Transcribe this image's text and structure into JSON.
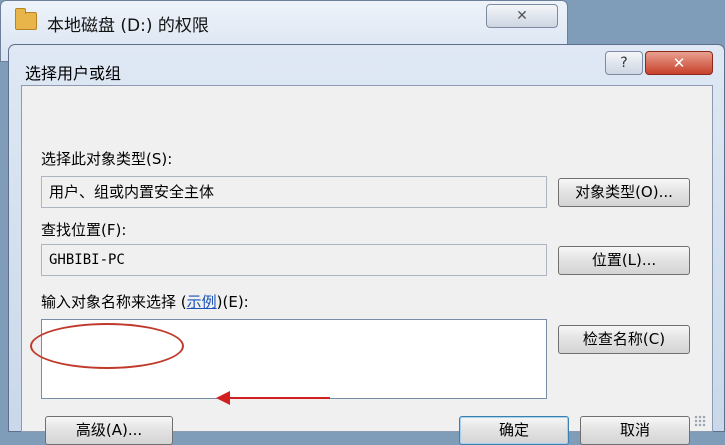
{
  "background_window": {
    "title": "本地磁盘 (D:) 的权限",
    "close_symbol": "✕"
  },
  "dialog": {
    "title": "选择用户或组",
    "help_symbol": "?",
    "close_symbol": "✕",
    "object_type": {
      "label": "选择此对象类型(S):",
      "value": "用户、组或内置安全主体",
      "button": "对象类型(O)..."
    },
    "location": {
      "label": "查找位置(F):",
      "value": "GHBIBI-PC",
      "button": "位置(L)..."
    },
    "names": {
      "label_before": "输入对象名称来选择 (",
      "label_link": "示例",
      "label_after": ")(E):",
      "value": "",
      "button": "检查名称(C)"
    },
    "advanced_button": "高级(A)...",
    "ok_button": "确定",
    "cancel_button": "取消"
  },
  "annotation": {
    "color": "#d21f1f"
  }
}
